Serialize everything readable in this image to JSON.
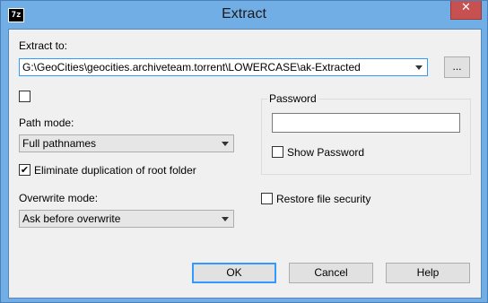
{
  "window": {
    "title": "Extract",
    "app_icon_text": "7z",
    "close_symbol": "✕"
  },
  "extract_to": {
    "label": "Extract to:",
    "path": "G:\\GeoCities\\geocities.archiveteam.torrent\\LOWERCASE\\ak-Extracted",
    "browse_label": "..."
  },
  "path_mode": {
    "label": "Path mode:",
    "value": "Full pathnames"
  },
  "eliminate_dup": {
    "label": "Eliminate duplication of root folder",
    "checked": true
  },
  "overwrite_mode": {
    "label": "Overwrite mode:",
    "value": "Ask before overwrite"
  },
  "password": {
    "group_label": "Password",
    "value": "",
    "show_label": "Show Password"
  },
  "restore_security": {
    "label": "Restore file security"
  },
  "buttons": {
    "ok": "OK",
    "cancel": "Cancel",
    "help": "Help"
  },
  "checkmark": "✔"
}
